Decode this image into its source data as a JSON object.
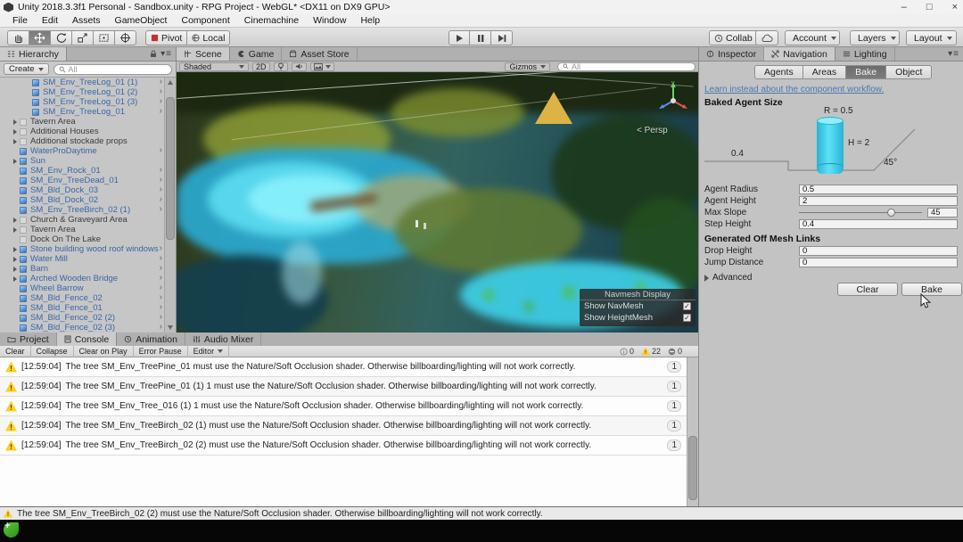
{
  "window": {
    "title": "Unity 2018.3.3f1 Personal - Sandbox.unity - RPG Project - WebGL* <DX11 on DX9 GPU>",
    "controls": {
      "minimize": "–",
      "maximize": "□",
      "close": "×"
    }
  },
  "menubar": {
    "items": [
      "File",
      "Edit",
      "Assets",
      "GameObject",
      "Component",
      "Cinemachine",
      "Window",
      "Help"
    ]
  },
  "toolbar": {
    "pivot_label": "Pivot",
    "local_label": "Local",
    "collab_label": "Collab",
    "account_label": "Account",
    "layers_label": "Layers",
    "layout_label": "Layout"
  },
  "hierarchy": {
    "tab": "Hierarchy",
    "create_button": "Create",
    "search_filter": "All",
    "items": [
      {
        "label": "SM_Env_TreeLog_01 (1)",
        "prefab": true,
        "expand": false,
        "chev": true,
        "deep": true
      },
      {
        "label": "SM_Env_TreeLog_01 (2)",
        "prefab": true,
        "expand": false,
        "chev": true,
        "deep": true
      },
      {
        "label": "SM_Env_TreeLog_01 (3)",
        "prefab": true,
        "expand": false,
        "chev": true,
        "deep": true
      },
      {
        "label": "SM_Env_TreeLog_01",
        "prefab": true,
        "expand": false,
        "chev": true,
        "deep": true
      },
      {
        "label": "Tavern Area",
        "prefab": false,
        "expand": true,
        "chev": false,
        "deep": false
      },
      {
        "label": "Additional Houses",
        "prefab": false,
        "expand": true,
        "chev": false,
        "deep": false
      },
      {
        "label": "Additional stockade props",
        "prefab": false,
        "expand": true,
        "chev": false,
        "deep": false
      },
      {
        "label": "WaterProDaytime",
        "prefab": true,
        "expand": false,
        "chev": true,
        "deep": false
      },
      {
        "label": "Sun",
        "prefab": true,
        "expand": true,
        "chev": false,
        "deep": false
      },
      {
        "label": "SM_Env_Rock_01",
        "prefab": true,
        "expand": false,
        "chev": true,
        "deep": false
      },
      {
        "label": "SM_Env_TreeDead_01",
        "prefab": true,
        "expand": false,
        "chev": true,
        "deep": false
      },
      {
        "label": "SM_Bld_Dock_03",
        "prefab": true,
        "expand": false,
        "chev": true,
        "deep": false
      },
      {
        "label": "SM_Bld_Dock_02",
        "prefab": true,
        "expand": false,
        "chev": true,
        "deep": false
      },
      {
        "label": "SM_Env_TreeBirch_02 (1)",
        "prefab": true,
        "expand": false,
        "chev": true,
        "deep": false
      },
      {
        "label": "Church & Graveyard Area",
        "prefab": false,
        "expand": true,
        "chev": false,
        "deep": false
      },
      {
        "label": "Tavern Area",
        "prefab": false,
        "expand": true,
        "chev": false,
        "deep": false
      },
      {
        "label": "Dock On The Lake",
        "prefab": false,
        "expand": false,
        "chev": false,
        "deep": false
      },
      {
        "label": "Stone building wood roof windows",
        "prefab": true,
        "expand": true,
        "chev": true,
        "deep": false
      },
      {
        "label": "Water Mill",
        "prefab": true,
        "expand": true,
        "chev": true,
        "deep": false
      },
      {
        "label": "Barn",
        "prefab": true,
        "expand": true,
        "chev": true,
        "deep": false
      },
      {
        "label": "Arched Wooden Bridge",
        "prefab": true,
        "expand": true,
        "chev": true,
        "deep": false
      },
      {
        "label": "Wheel Barrow",
        "prefab": true,
        "expand": false,
        "chev": true,
        "deep": false
      },
      {
        "label": "SM_Bld_Fence_02",
        "prefab": true,
        "expand": false,
        "chev": true,
        "deep": false
      },
      {
        "label": "SM_Bld_Fence_01",
        "prefab": true,
        "expand": false,
        "chev": true,
        "deep": false
      },
      {
        "label": "SM_Bld_Fence_02 (2)",
        "prefab": true,
        "expand": false,
        "chev": true,
        "deep": false
      },
      {
        "label": "SM_Bld_Fence_02 (3)",
        "prefab": true,
        "expand": false,
        "chev": true,
        "deep": false
      }
    ]
  },
  "scene": {
    "tab_scene": "Scene",
    "tab_game": "Game",
    "tab_asset_store": "Asset Store",
    "shading_mode": "Shaded",
    "mode_2d": "2D",
    "gizmos_button": "Gizmos",
    "search_filter": "All",
    "persp_label": "< Persp",
    "axis_x": "x",
    "axis_y": "y",
    "axis_z": "z",
    "navmesh_overlay": {
      "title": "Navmesh Display",
      "show_navmesh": "Show NavMesh",
      "show_heightmesh": "Show HeightMesh",
      "check_glyph": "✓"
    }
  },
  "inspector": {
    "tab_inspector": "Inspector",
    "tab_navigation": "Navigation",
    "tab_lighting": "Lighting",
    "subtab_agents": "Agents",
    "subtab_areas": "Areas",
    "subtab_bake": "Bake",
    "subtab_object": "Object",
    "workflow_link": "Learn instead about the component workflow.",
    "section_title": "Baked Agent Size",
    "diagram": {
      "radius_label": "R = 0.5",
      "height_label": "H = 2",
      "step_label": "0.4",
      "slope_label": "45°"
    },
    "agent_radius": {
      "label": "Agent Radius",
      "value": "0.5"
    },
    "agent_height": {
      "label": "Agent Height",
      "value": "2"
    },
    "max_slope": {
      "label": "Max Slope",
      "value": "45"
    },
    "step_height": {
      "label": "Step Height",
      "value": "0.4"
    },
    "offmesh_title": "Generated Off Mesh Links",
    "drop_height": {
      "label": "Drop Height",
      "value": "0"
    },
    "jump_distance": {
      "label": "Jump Distance",
      "value": "0"
    },
    "advanced_foldout": "Advanced",
    "clear_button": "Clear",
    "bake_button": "Bake",
    "agent_color": "#3fd2ee"
  },
  "console": {
    "tab_project": "Project",
    "tab_console": "Console",
    "tab_animation": "Animation",
    "tab_audio_mixer": "Audio Mixer",
    "btn_clear": "Clear",
    "btn_collapse": "Collapse",
    "btn_clear_on_play": "Clear on Play",
    "btn_error_pause": "Error Pause",
    "btn_editor": "Editor",
    "info_count": "0",
    "warning_count": "22",
    "error_count": "0",
    "messages": [
      {
        "time": "[12:59:04]",
        "text": "The tree SM_Env_TreePine_01 must use the Nature/Soft Occlusion shader. Otherwise billboarding/lighting will not work correctly.",
        "count": "1"
      },
      {
        "time": "[12:59:04]",
        "text": "The tree SM_Env_TreePine_01 (1) 1 must use the Nature/Soft Occlusion shader. Otherwise billboarding/lighting will not work correctly.",
        "count": "1"
      },
      {
        "time": "[12:59:04]",
        "text": "The tree SM_Env_Tree_016 (1) 1 must use the Nature/Soft Occlusion shader. Otherwise billboarding/lighting will not work correctly.",
        "count": "1"
      },
      {
        "time": "[12:59:04]",
        "text": "The tree SM_Env_TreeBirch_02 (1) must use the Nature/Soft Occlusion shader. Otherwise billboarding/lighting will not work correctly.",
        "count": "1"
      },
      {
        "time": "[12:59:04]",
        "text": "The tree SM_Env_TreeBirch_02 (2) must use the Nature/Soft Occlusion shader. Otherwise billboarding/lighting will not work correctly.",
        "count": "1"
      }
    ]
  },
  "statusbar": {
    "message": "The tree SM_Env_TreeBirch_02 (2) must use the Nature/Soft Occlusion shader. Otherwise billboarding/lighting will not work correctly."
  }
}
